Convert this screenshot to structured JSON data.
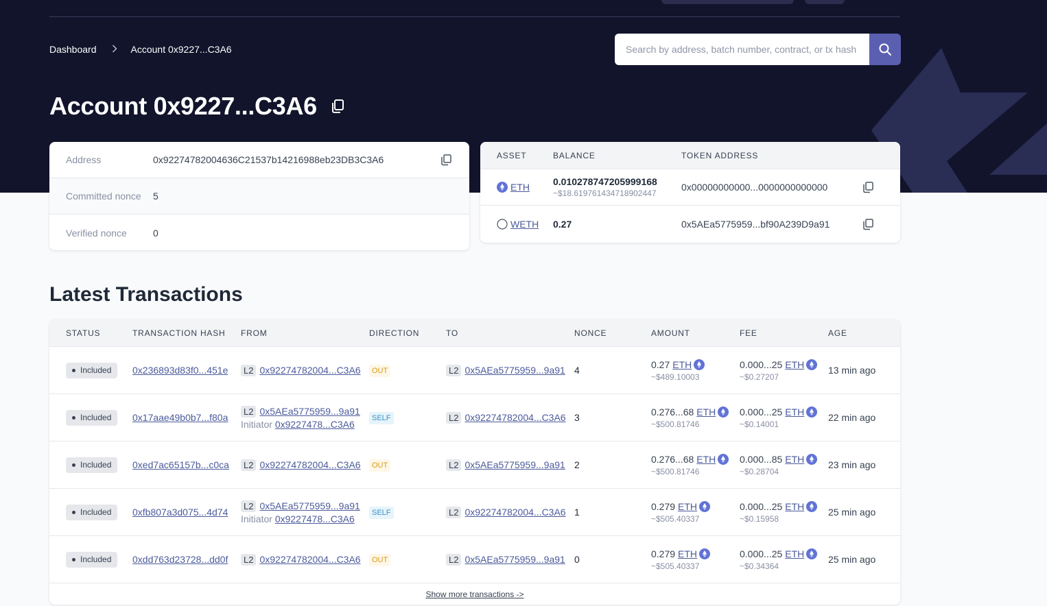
{
  "breadcrumb": {
    "home": "Dashboard",
    "separator": ">",
    "current": "Account 0x9227...C3A6"
  },
  "search": {
    "placeholder": "Search by address, batch number, contract, or tx hash",
    "icon": "search-icon"
  },
  "page_title": "Account 0x9227...C3A6",
  "account_info": {
    "address_label": "Address",
    "address_value": "0x92274782004636C21537b14216988eb23DB3C3A6",
    "committed_label": "Committed nonce",
    "committed_value": "5",
    "verified_label": "Verified nonce",
    "verified_value": "0"
  },
  "balances": {
    "headers": {
      "asset": "ASSET",
      "balance": "BALANCE",
      "token_address": "TOKEN ADDRESS"
    },
    "rows": [
      {
        "asset": "ETH",
        "balance": "0.010278747205999168",
        "usd": "~$18.619761434718902447",
        "token": "0x00000000000...0000000000000"
      },
      {
        "asset": "WETH",
        "balance": "0.27",
        "usd": "",
        "token": "0x5AEa5775959...bf90A239D9a91"
      }
    ]
  },
  "transactions": {
    "title": "Latest Transactions",
    "headers": {
      "status": "STATUS",
      "hash": "TRANSACTION HASH",
      "from": "FROM",
      "direction": "DIRECTION",
      "to": "TO",
      "nonce": "NONCE",
      "amount": "AMOUNT",
      "fee": "FEE",
      "age": "AGE"
    },
    "network_tag": "L2",
    "initiator_label": "Initiator",
    "rows": [
      {
        "status": "Included",
        "hash": "0x236893d83f0...451e",
        "from": "0x92274782004...C3A6",
        "initiator": "",
        "direction": "OUT",
        "to": "0x5AEa5775959...9a91",
        "nonce": "4",
        "amount": "0.27",
        "amount_token": "ETH",
        "amount_usd": "~$489.10003",
        "fee": "0.000...25",
        "fee_token": "ETH",
        "fee_usd": "~$0.27207",
        "age": "13 min ago"
      },
      {
        "status": "Included",
        "hash": "0x17aae49b0b7...f80a",
        "from": "0x5AEa5775959...9a91",
        "initiator": "0x9227478...C3A6",
        "direction": "SELF",
        "to": "0x92274782004...C3A6",
        "nonce": "3",
        "amount": "0.276...68",
        "amount_token": "ETH",
        "amount_usd": "~$500.81746",
        "fee": "0.000...25",
        "fee_token": "ETH",
        "fee_usd": "~$0.14001",
        "age": "22 min ago"
      },
      {
        "status": "Included",
        "hash": "0xed7ac65157b...c0ca",
        "from": "0x92274782004...C3A6",
        "initiator": "",
        "direction": "OUT",
        "to": "0x5AEa5775959...9a91",
        "nonce": "2",
        "amount": "0.276...68",
        "amount_token": "ETH",
        "amount_usd": "~$500.81746",
        "fee": "0.000...85",
        "fee_token": "ETH",
        "fee_usd": "~$0.28704",
        "age": "23 min ago"
      },
      {
        "status": "Included",
        "hash": "0xfb807a3d075...4d74",
        "from": "0x5AEa5775959...9a91",
        "initiator": "0x9227478...C3A6",
        "direction": "SELF",
        "to": "0x92274782004...C3A6",
        "nonce": "1",
        "amount": "0.279",
        "amount_token": "ETH",
        "amount_usd": "~$505.40337",
        "fee": "0.000...25",
        "fee_token": "ETH",
        "fee_usd": "~$0.15958",
        "age": "25 min ago"
      },
      {
        "status": "Included",
        "hash": "0xdd763d23728...dd0f",
        "from": "0x92274782004...C3A6",
        "initiator": "",
        "direction": "OUT",
        "to": "0x5AEa5775959...9a91",
        "nonce": "0",
        "amount": "0.279",
        "amount_token": "ETH",
        "amount_usd": "~$505.40337",
        "fee": "0.000...25",
        "fee_token": "ETH",
        "fee_usd": "~$0.34364",
        "age": "25 min ago"
      }
    ],
    "show_more": "Show more transactions ->"
  },
  "colors": {
    "hero_bg": "#11142b",
    "accent": "#5a5fb0",
    "link": "#4b5a9a",
    "out_badge": "#d99a1e",
    "self_badge": "#3a93c4"
  }
}
